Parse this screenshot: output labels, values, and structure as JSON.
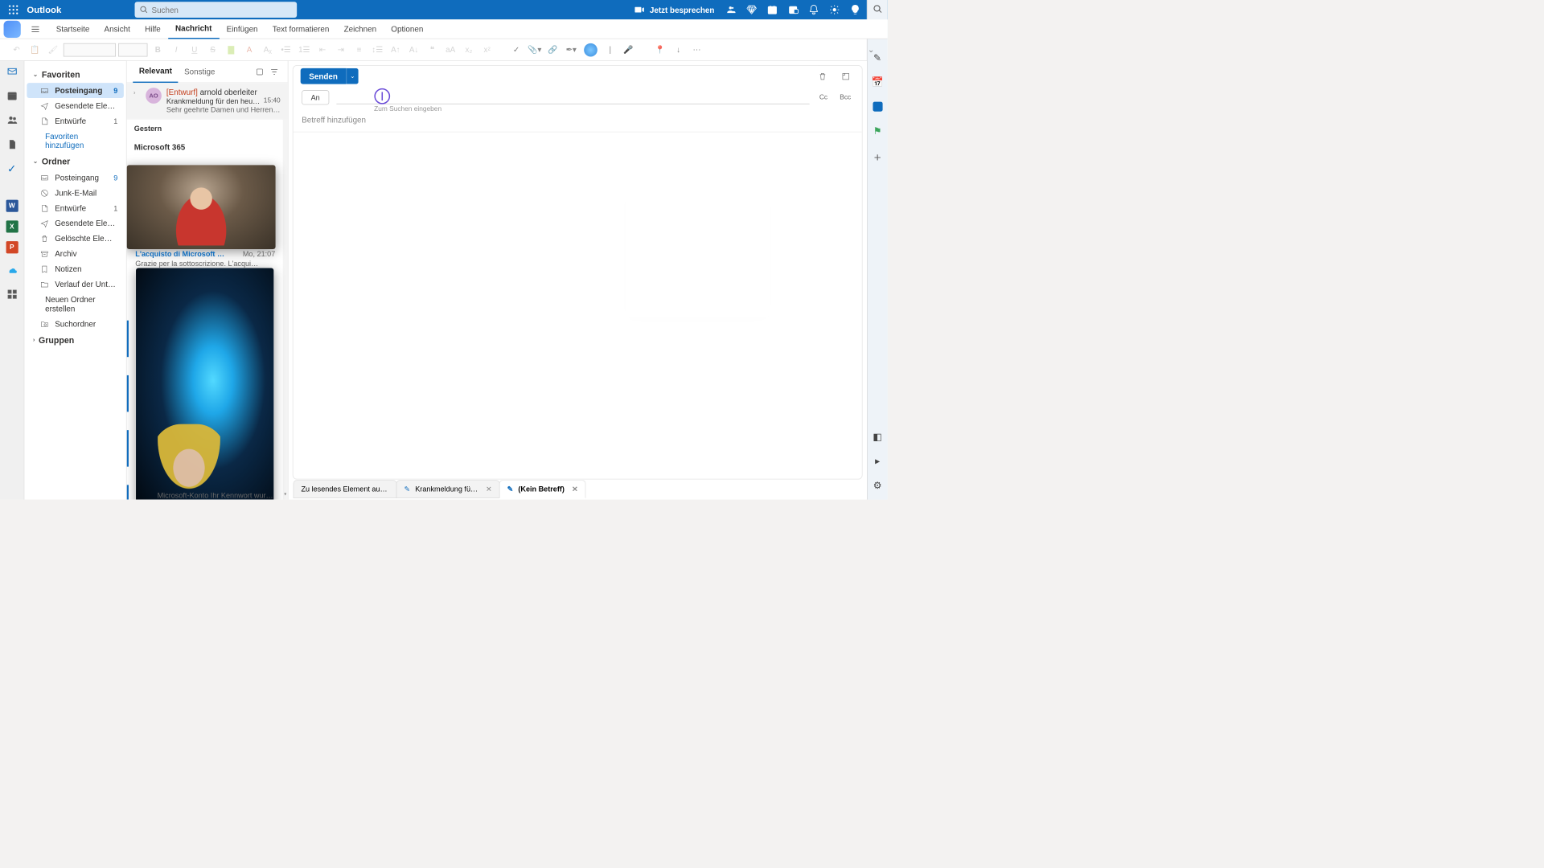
{
  "app_name": "Outlook",
  "search_placeholder": "Suchen",
  "meet_now": "Jetzt besprechen",
  "ribbon_tabs": {
    "home": "Startseite",
    "view": "Ansicht",
    "help": "Hilfe",
    "message": "Nachricht",
    "insert": "Einfügen",
    "format": "Text formatieren",
    "draw": "Zeichnen",
    "options": "Optionen"
  },
  "folders": {
    "favorites_header": "Favoriten",
    "inbox": "Posteingang",
    "inbox_count": "9",
    "sent": "Gesendete Elemente",
    "drafts": "Entwürfe",
    "drafts_count": "1",
    "add_fav": "Favoriten hinzufügen",
    "folders_header": "Ordner",
    "junk": "Junk-E-Mail",
    "deleted": "Gelöschte Elemente",
    "archive": "Archiv",
    "notes": "Notizen",
    "conv": "Verlauf der Unterhalt…",
    "newfolder": "Neuen Ordner erstellen",
    "searchfolders": "Suchordner",
    "groups_header": "Gruppen"
  },
  "list": {
    "tab_focused": "Relevant",
    "tab_other": "Sonstige",
    "msg1": {
      "avatar": "AO",
      "draft_tag": "[Entwurf]",
      "from": "arnold oberleiter",
      "subject": "Krankmeldung für den heut…",
      "time": "15:40",
      "preview": "Sehr geehrte Damen und Herren, i…"
    },
    "date_yesterday": "Gestern",
    "peek_sender": "Microsoft 365",
    "peek_subject": "L'acquisto di Microsoft …",
    "peek_time": "Mo, 21:07",
    "peek_preview": "Grazie per la sottoscrizione. L'acqui…",
    "bottom_preview": "Microsoft-Konto Ihr Kennwort wur…"
  },
  "compose": {
    "send": "Senden",
    "to_button": "An",
    "to_hint": "Zum Suchen eingeben",
    "cc": "Cc",
    "bcc": "Bcc",
    "subject_placeholder": "Betreff hinzufügen"
  },
  "tabs": {
    "t1": "Zu lesendes Element ausw…",
    "t2": "Krankmeldung für …",
    "t3": "(Kein Betreff)"
  }
}
